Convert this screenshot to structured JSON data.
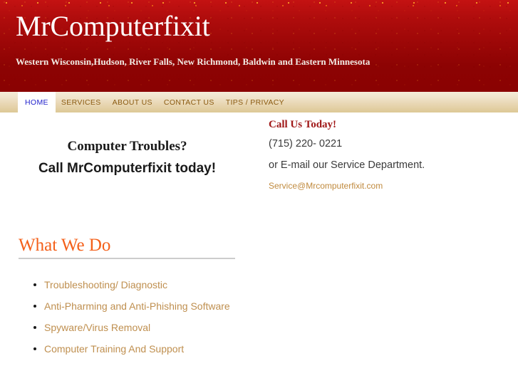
{
  "header": {
    "site_title": "MrComputerfixit",
    "tagline": "Western Wisconsin,Hudson, River Falls, New Richmond, Baldwin and Eastern Minnesota",
    "banner_color_top": "#c41212",
    "banner_color_bottom": "#8a0202"
  },
  "nav": {
    "items": [
      {
        "label": "HOME",
        "active": true
      },
      {
        "label": "SERVICES",
        "active": false
      },
      {
        "label": "ABOUT US",
        "active": false
      },
      {
        "label": "CONTACT US",
        "active": false
      },
      {
        "label": "TIPS / PRIVACY",
        "active": false
      }
    ],
    "active_text_color": "#2222cc",
    "inactive_text_color": "#8a5a10"
  },
  "main": {
    "headline": {
      "line1": "Computer Troubles?",
      "line2": "Call MrComputerfixit today!"
    },
    "contact": {
      "title": "Call Us Today!",
      "title_color": "#a01818",
      "phone": "(715) 220- 0221",
      "email_note": "or E-mail our Service Department.",
      "email": "Service@Mrcomputerfixit.com",
      "email_color": "#c08a3e"
    },
    "services": {
      "heading": "What We Do",
      "heading_color": "#f4601a",
      "items": [
        "Troubleshooting/ Diagnostic",
        "Anti-Pharming and Anti-Phishing Software",
        "Spyware/Virus Removal",
        "Computer Training And Support"
      ],
      "item_color": "#bf8f4f"
    }
  }
}
